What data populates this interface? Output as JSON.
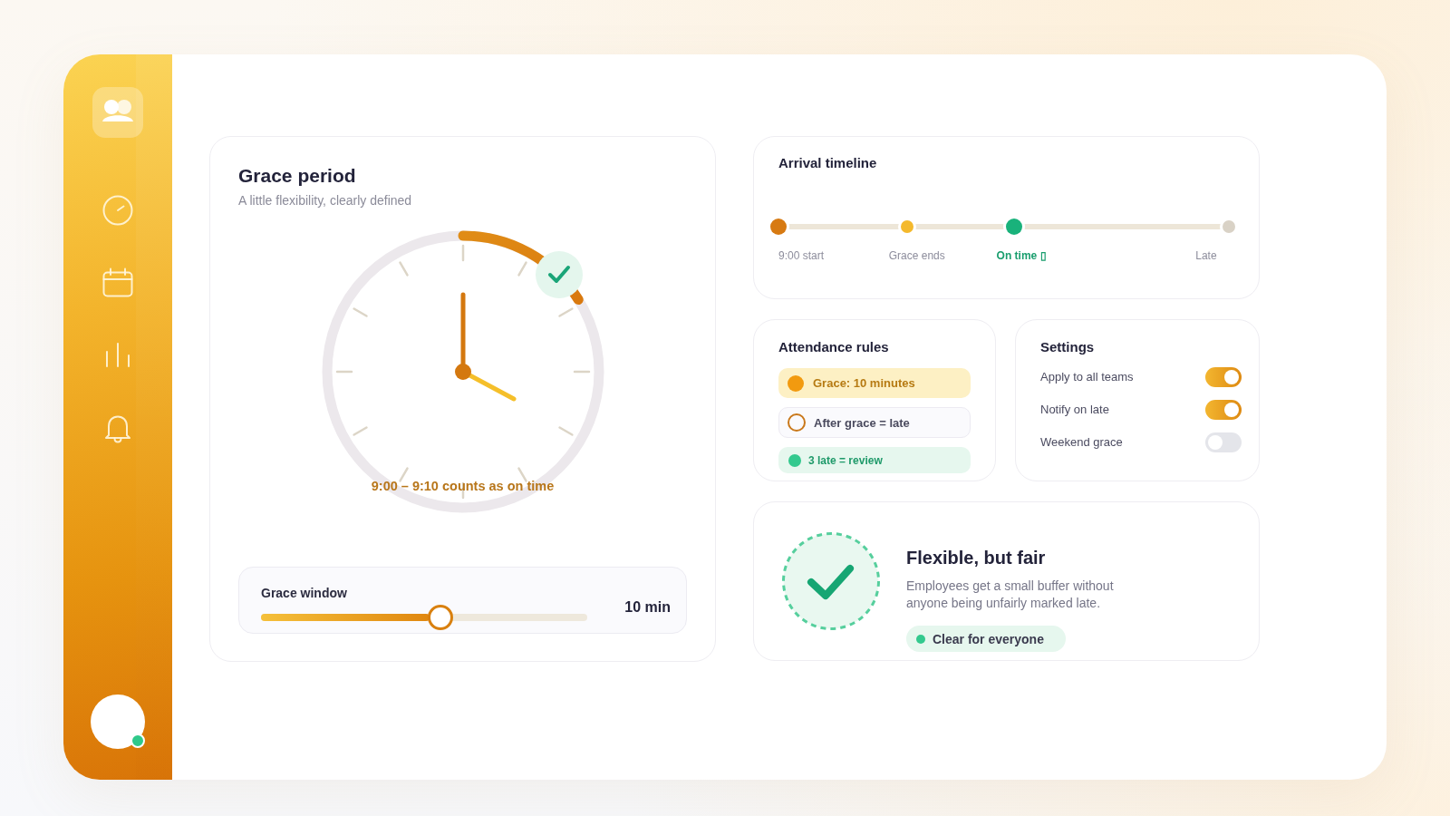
{
  "sidebar": {
    "avatar": {
      "online": true
    }
  },
  "grace_card": {
    "title": "Grace period",
    "subtitle": "A little flexibility, clearly defined",
    "caption": "9:00 – 9:10 counts as on time",
    "slider": {
      "label": "Grace window",
      "value": "10 min",
      "level": 0.55
    }
  },
  "timeline": {
    "title": "Arrival timeline",
    "stops": [
      {
        "label": "9:00 start",
        "kind": "major",
        "color": "#d77a12",
        "selected": false
      },
      {
        "label": "Grace ends",
        "kind": "minor",
        "color": "#f4b92c",
        "selected": false
      },
      {
        "label": "On time ▯",
        "kind": "major",
        "color": "#19b27b",
        "selected": true
      },
      {
        "label": "Late",
        "kind": "minor",
        "color": "#d9d2c6",
        "selected": false
      }
    ]
  },
  "rules": {
    "title": "Attendance rules",
    "items": [
      {
        "kind": "highlight",
        "text": "Grace: 10 minutes"
      },
      {
        "kind": "outline",
        "text": "After grace = late"
      },
      {
        "kind": "success",
        "text": "3 late = review"
      }
    ]
  },
  "settings": {
    "title": "Settings",
    "items": [
      {
        "label": "Apply to all teams",
        "on": true
      },
      {
        "label": "Notify on late",
        "on": true
      },
      {
        "label": "Weekend grace",
        "on": false
      }
    ]
  },
  "summary": {
    "title": "Flexible, but fair",
    "description": "Employees get a small buffer without anyone being unfairly marked late.",
    "status": "Clear for everyone"
  }
}
